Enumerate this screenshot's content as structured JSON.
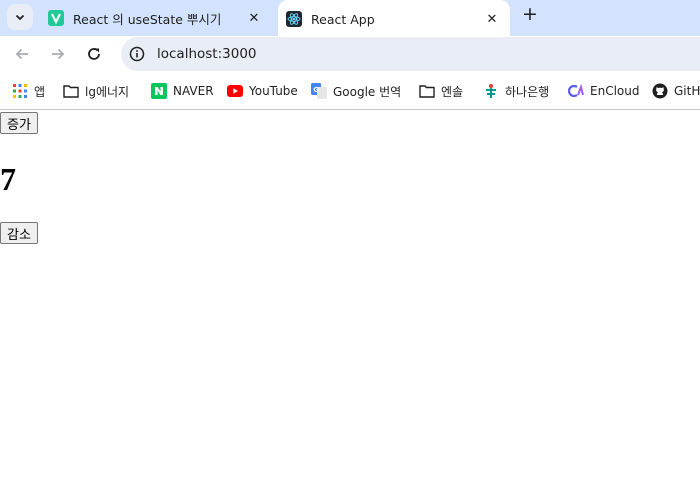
{
  "browser": {
    "tabs": [
      {
        "title": "React 의 useState 뿌시기",
        "favicon": "velog-icon",
        "active": false
      },
      {
        "title": "React App",
        "favicon": "react-icon",
        "active": true
      }
    ],
    "address": "localhost:3000",
    "bookmarks": [
      {
        "label": "앱",
        "icon": "apps-grid-icon"
      },
      {
        "label": "lg에너지",
        "icon": "folder-icon"
      },
      {
        "label": "NAVER",
        "icon": "naver-icon"
      },
      {
        "label": "YouTube",
        "icon": "youtube-icon"
      },
      {
        "label": "Google 번역",
        "icon": "google-translate-icon"
      },
      {
        "label": "엔솔",
        "icon": "folder-icon"
      },
      {
        "label": "하나은행",
        "icon": "hana-bank-icon"
      },
      {
        "label": "EnCloud",
        "icon": "encloud-icon"
      },
      {
        "label": "GitH",
        "icon": "github-icon"
      }
    ]
  },
  "app": {
    "increment_label": "증가",
    "count": "7",
    "decrement_label": "감소"
  }
}
